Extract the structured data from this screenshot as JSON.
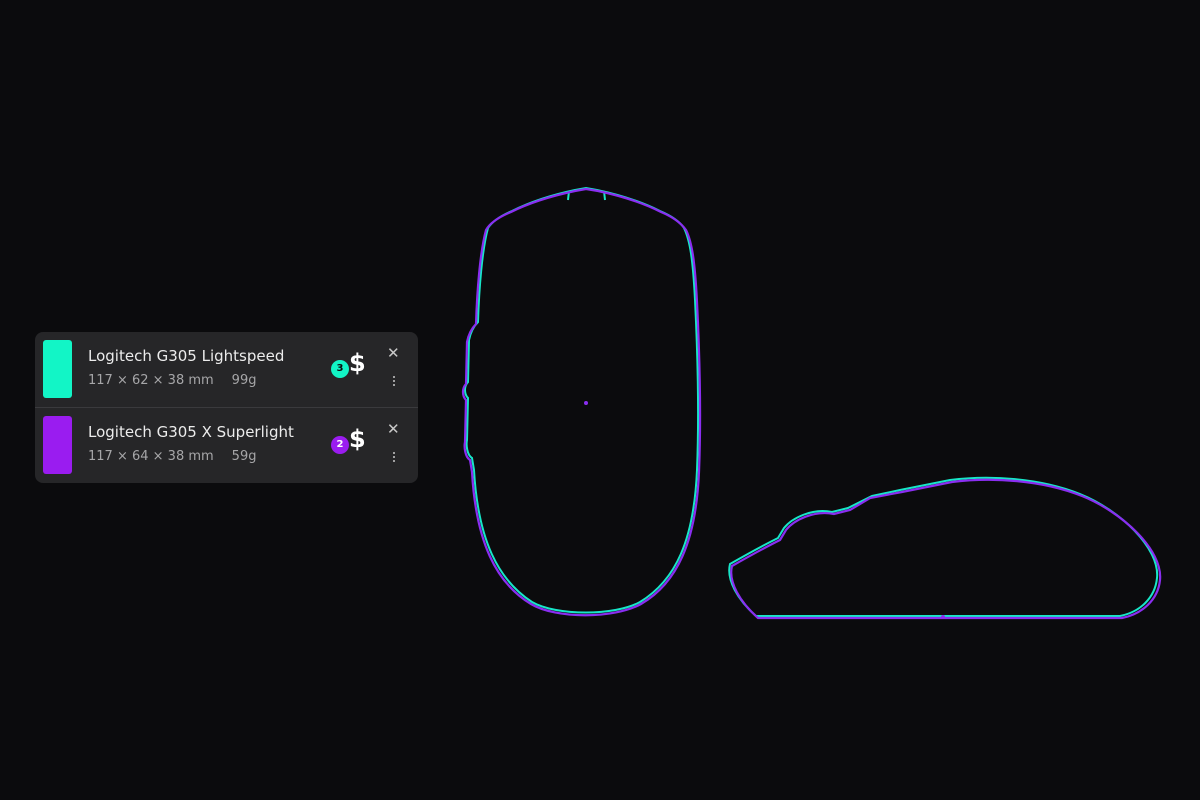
{
  "colors": {
    "background": "#0b0b0d",
    "panel": "#262628",
    "teal": "#12f5c6",
    "purple": "#9a1cf0",
    "outline_teal": "#17e6c8",
    "outline_purple": "#8a2ef0"
  },
  "mice": [
    {
      "name": "Logitech G305 Lightspeed",
      "dimensions": "117 × 62 × 38 mm",
      "weight": "99g",
      "badge": "3",
      "price_symbol": "$",
      "close_icon": "close-icon",
      "menu_icon": "more-vertical-icon"
    },
    {
      "name": "Logitech G305 X Superlight",
      "dimensions": "117 × 64 × 38 mm",
      "weight": "59g",
      "badge": "2",
      "price_symbol": "$",
      "close_icon": "close-icon",
      "menu_icon": "more-vertical-icon"
    }
  ],
  "views": {
    "top": "mouse-top-view-outline",
    "side": "mouse-side-view-outline"
  }
}
